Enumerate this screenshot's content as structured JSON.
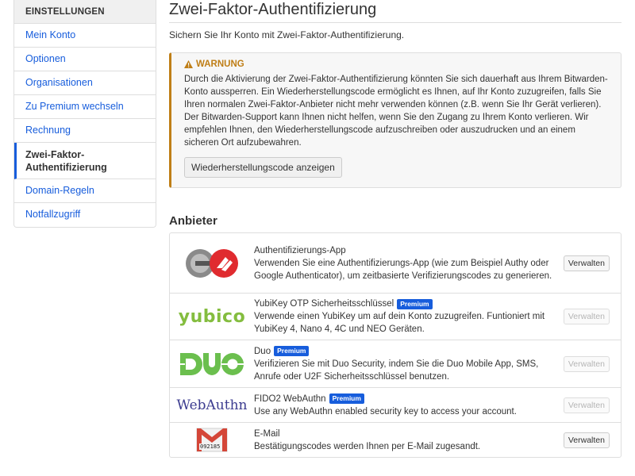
{
  "sidebar": {
    "header": "EINSTELLUNGEN",
    "items": [
      {
        "label": "Mein Konto"
      },
      {
        "label": "Optionen"
      },
      {
        "label": "Organisationen"
      },
      {
        "label": "Zu Premium wechseln"
      },
      {
        "label": "Rechnung"
      },
      {
        "label": "Zwei-Faktor-Authentifizierung",
        "active": true
      },
      {
        "label": "Domain-Regeln"
      },
      {
        "label": "Notfallzugriff"
      }
    ]
  },
  "main": {
    "title": "Zwei-Faktor-Authentifizierung",
    "description": "Sichern Sie Ihr Konto mit Zwei-Faktor-Authentifizierung.",
    "warning": {
      "title": "WARNUNG",
      "body": "Durch die Aktivierung der Zwei-Faktor-Authentifizierung könnten Sie sich dauerhaft aus Ihrem Bitwarden-Konto aussperren. Ein Wiederherstellungscode ermöglicht es Ihnen, auf Ihr Konto zuzugreifen, falls Sie Ihren normalen Zwei-Faktor-Anbieter nicht mehr verwenden können (z.B. wenn Sie Ihr Gerät verlieren). Der Bitwarden-Support kann Ihnen nicht helfen, wenn Sie den Zugang zu Ihrem Konto verlieren. Wir empfehlen Ihnen, den Wiederherstellungscode aufzuschreiben oder auszudrucken und an einem sicheren Ort aufzubewahren.",
      "button": "Wiederherstellungscode anzeigen",
      "color": "#bf7e16"
    },
    "providers_title": "Anbieter",
    "providers": [
      {
        "name": "Authentifizierungs-App",
        "desc": "Verwenden Sie eine Authentifizierungs-App (wie zum Beispiel Authy oder Google Authenticator), um zeitbasierte Verifizierungscodes zu generieren.",
        "button": "Verwalten",
        "premium": false,
        "logo": "authenticator-logo"
      },
      {
        "name": "YubiKey OTP Sicherheitsschlüssel",
        "desc": "Verwende einen YubiKey um auf dein Konto zuzugreifen. Funtioniert mit YubiKey 4, Nano 4, 4C und NEO Geräten.",
        "button": "Verwalten",
        "premium": true,
        "badge": "Premium",
        "logo": "yubico-logo",
        "logo_text": "yubico"
      },
      {
        "name": "Duo",
        "desc": "Verifizieren Sie mit Duo Security, indem Sie die Duo Mobile App, SMS, Anrufe oder U2F Sicherheitsschlüssel benutzen.",
        "button": "Verwalten",
        "premium": true,
        "badge": "Premium",
        "logo": "duo-logo"
      },
      {
        "name": "FIDO2 WebAuthn",
        "desc": "Use any WebAuthn enabled security key to access your account.",
        "button": "Verwalten",
        "premium": true,
        "badge": "Premium",
        "logo": "webauthn-logo",
        "logo_text": "WebAuthn"
      },
      {
        "name": "E-Mail",
        "desc": "Bestätigungscodes werden Ihnen per E-Mail zugesandt.",
        "button": "Verwalten",
        "premium": false,
        "logo": "email-logo",
        "logo_text": "092185"
      }
    ]
  },
  "colors": {
    "accent": "#175ddc",
    "yubico_green": "#84bd3f",
    "duo_green": "#6bbf4e",
    "webauthn_blue": "#3b3b8f",
    "gmail_red": "#d44638"
  }
}
